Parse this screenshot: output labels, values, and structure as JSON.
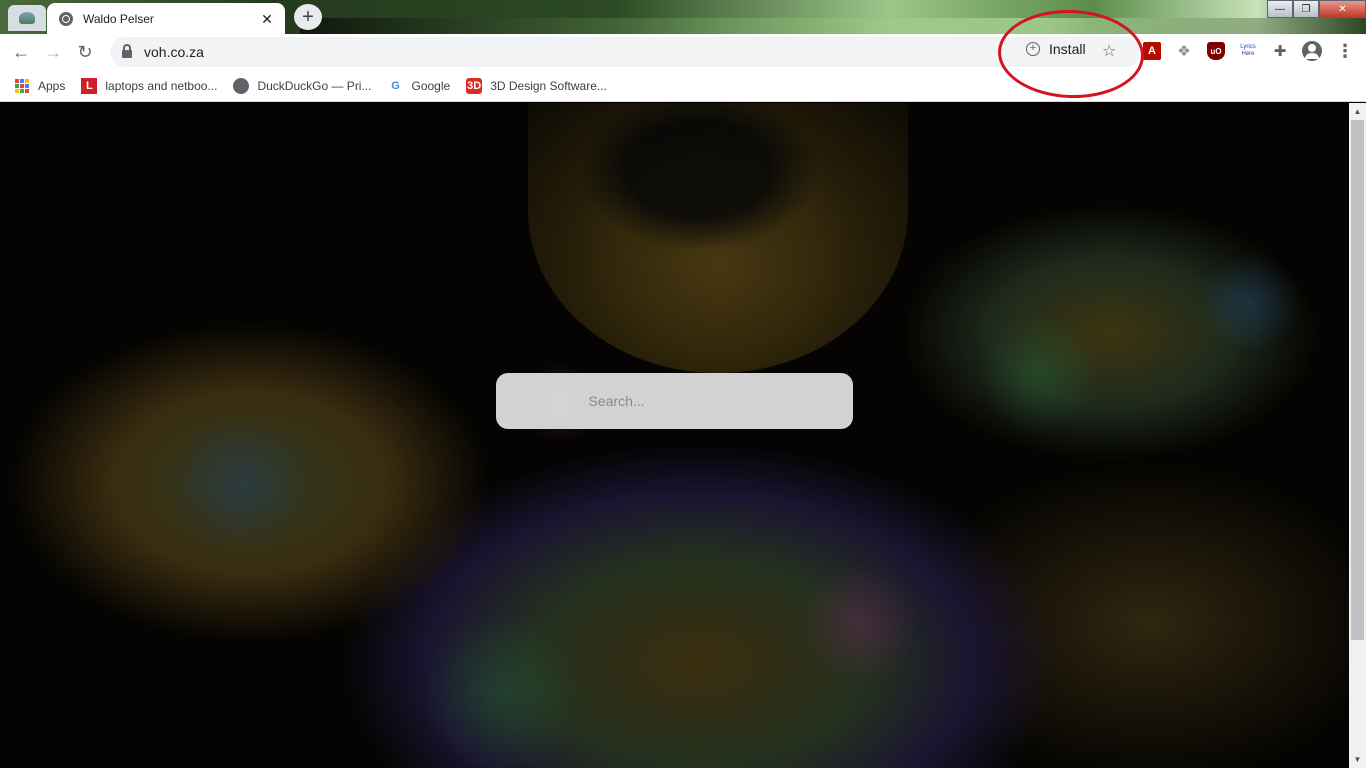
{
  "tab": {
    "title": "Waldo Pelser",
    "close": "✕",
    "new_tab": "+"
  },
  "window_controls": {
    "minimize": "—",
    "maximize": "❐",
    "close": "✕"
  },
  "toolbar": {
    "back": "←",
    "forward": "→",
    "reload": "↻",
    "url": "voh.co.za",
    "install_label": "Install",
    "bookmark_star": "☆",
    "menu": "⋮"
  },
  "extensions": {
    "pdf": "A",
    "dropbox": "❖",
    "ublock": "uO",
    "lyrics_line1": "Lyrics",
    "lyrics_line2": "Here",
    "puzzle": "✚"
  },
  "bookmarks": [
    {
      "label": "Apps",
      "icon": "apps-grid-icon"
    },
    {
      "label": "laptops and netboo...",
      "icon": "l-logo-icon"
    },
    {
      "label": "DuckDuckGo — Pri...",
      "icon": "globe-icon"
    },
    {
      "label": "Google",
      "icon": "google-g-icon"
    },
    {
      "label": "3D Design Software...",
      "icon": "3d-design-icon"
    }
  ],
  "icons": {
    "l_logo": "L",
    "google_g": "G",
    "threed": "3D"
  },
  "search": {
    "placeholder": "Search..."
  },
  "scrollbar": {
    "up": "▲",
    "down": "▼"
  },
  "colors": {
    "annotation_circle": "#d4141c",
    "tab_bg": "#ffffff",
    "toolbar_bg": "#ffffff",
    "omnibox_bg": "#f1f3f4"
  }
}
